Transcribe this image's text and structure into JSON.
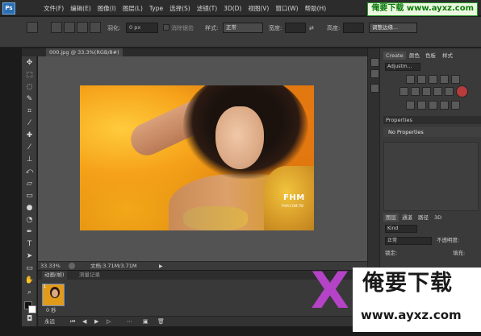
{
  "menubar": {
    "logo": "Ps",
    "items": [
      "文件(F)",
      "编辑(E)",
      "图像(I)",
      "图层(L)",
      "Type",
      "选择(S)",
      "滤镜(T)",
      "3D(D)",
      "视图(V)",
      "窗口(W)",
      "帮助(H)"
    ],
    "watermark": "俺要下载 www.ayxz.com"
  },
  "options": {
    "feather_label": "羽化:",
    "feather_value": "0 px",
    "antialias_label": "消除锯齿",
    "style_label": "样式:",
    "style_value": "正常",
    "width_label": "宽度:",
    "height_label": "高度:",
    "refine_button": "调整边缘..."
  },
  "document": {
    "tab_title": "000.jpg @ 33.3%(RGB/8#)",
    "zoom": "33.33%",
    "doc_size": "文档:3.71M/3.71M",
    "image_brand": "FHM",
    "image_brand_sub": "FHM.COM.TW"
  },
  "animation": {
    "tabs": [
      "动画(帧)",
      "测量记录"
    ],
    "frame_number": "1",
    "frame_time": "0 秒",
    "loop": "永远"
  },
  "panels": {
    "top_tabs": [
      "Create",
      "颜色",
      "色板",
      "样式"
    ],
    "adjustments_label": "Adjustm...",
    "properties_label": "Properties",
    "no_properties": "No Properties",
    "layers_tabs": [
      "图层",
      "通道",
      "路径",
      "3D"
    ],
    "kind_label": "Kind",
    "blend_mode": "正常",
    "opacity_label": "不透明度:",
    "lock_label": "锁定:",
    "fill_label": "填充:"
  },
  "overlay": {
    "logo_x": "X",
    "title": "俺要下载",
    "url": "www.ayxz.com"
  }
}
